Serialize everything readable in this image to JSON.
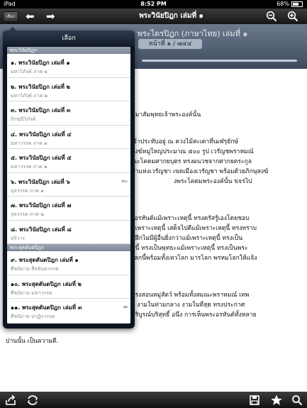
{
  "status": {
    "device": "iPad",
    "time": "8:52 PM",
    "battery": "68%",
    "battery_level": 0.68
  },
  "nav": {
    "select_label": "เลือก",
    "title": "พระวินัยปิฎก เล่มที่ ๑",
    "back_icon": "arrow-left-icon",
    "forward_icon": "arrow-right-icon",
    "zoom_out_icon": "zoom-out-icon",
    "zoom_in_icon": "zoom-in-icon"
  },
  "content": {
    "title": "พระไตรปิฎก (ภาษาไทย) เล่มที่ ๑",
    "page": "หน้าที่ ๑ / ๗๔๔",
    "lines": [
      "มมาสัมพุทธเจ้าพระองค์นั้น",
      "เจ้าประทับอยู่ ณ ควงไม้สะเดาที่นเฬรุยักษ์",
      "สงฆ์หมู่ใหญ่ประมาณ ๕๐๐ รูป เวรัญชพราหมณ์",
      "ณะโคดมศากยบุตร ทรงผนวชจากศากยตระกูล",
      "ทำแห่งเวรัญชา เขตเมืองเวรัญชา พร้อมด้วยภิกษุสงฆ์",
      "งพระโคดมพระองค์นั้น ขจรไป",
      "ะอรหันต์แม้เพราะเหตุนี้ ทรงตรัสรู้เองโดยชอบ",
      "ม้เพราะเหตุนี้ เสด็จไปดีแม้เพราะเหตุนี้ ทรงทราบ",
      "มฝึกไม่มีผู้อื่นยิ่งกว่าแม้เพราะเหตุนี้ ทรงเป็น",
      "ทุนี้ ทรงเป็นพุทธะแม้เพราะเหตุนี้ ทรงเป็นพระ",
      "โลกนี้พร้อมทั้งเทวโลก มารโลก พรหมโลกให้แจ้ง",
      "ทรงสอนหมู่สัตว์ พร้อมทั้งสมณะพราหมณ์ เทพ",
      "ม งามในท่ามกลาง งามในที่สุด ทรงประกาศ",
      "บริบูรณ์บริสุทธิ์ อนึ่ง การเห็นพระอรหันต์ทั้งหลาย"
    ],
    "last_line": "ปานนั้น เป็นความดี."
  },
  "popover": {
    "title": "เลือก",
    "sections": [
      {
        "name": "พระวินัยปิฎก"
      },
      {
        "name": "พระสุตตันตปิฎก"
      }
    ],
    "items": [
      {
        "title": "๑. พระวินัยปิฎก เล่มที่ ๑",
        "sub": "มหาวิภังค์ ภาค ๑"
      },
      {
        "title": "๒. พระวินัยปิฎก เล่มที่ ๒",
        "sub": "มหาวิภังค์ ภาค ๒"
      },
      {
        "title": "๓. พระวินัยปิฎก เล่มที่ ๓",
        "sub": "ภิกขุนีวิภังค์"
      },
      {
        "title": "๔. พระวินัยปิฎก เล่มที่ ๔",
        "sub": "มหาวรรค ภาค ๑"
      },
      {
        "title": "๕. พระวินัยปิฎก เล่มที่ ๕",
        "sub": "มหาวรรค ภาค ๒"
      },
      {
        "title": "๖. พระวินัยปิฎก เล่มที่ ๖",
        "sub": "จุลวรรค ภาค ๑"
      },
      {
        "title": "๗. พระวินัยปิฎก เล่มที่ ๗",
        "sub": "จุลวรรค ภาค ๒"
      },
      {
        "title": "๘. พระวินัยปิฎก เล่มที่ ๘",
        "sub": "ปริวาร"
      },
      {
        "title": "๙. พระสุตตันตปิฎก เล่มที่ ๑",
        "sub": "ทีฆนิกาย สีลขันธวรรค"
      },
      {
        "title": "๑๐. พระสุตตันตปิฎก เล่มที่ ๒",
        "sub": "ทีฆนิกาย มหาวรรค"
      },
      {
        "title": "๑๑. พระสุตตันตปิฎก เล่มที่ ๓",
        "sub": "ทีฆนิกาย ปาฏิกวรรค"
      }
    ],
    "index_labels": [
      "พระ",
      "สุต"
    ]
  },
  "toolbar": {
    "share_icon": "share-icon",
    "refresh_icon": "sync-icon",
    "save_icon": "save-icon",
    "bookmark_icon": "star-icon",
    "search_icon": "search-icon"
  }
}
